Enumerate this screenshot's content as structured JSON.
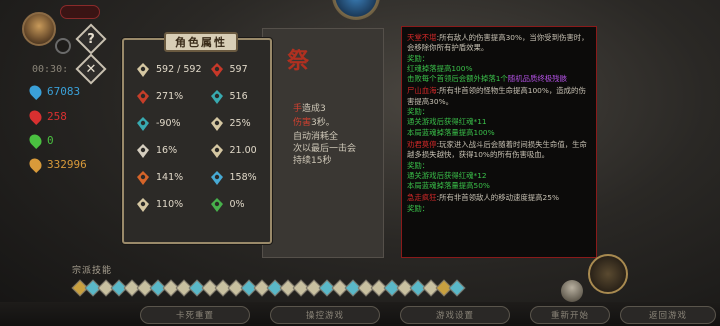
{
  "hud": {
    "timer": "00:30:",
    "help_label": "?",
    "close_label": "✕",
    "resources": [
      {
        "icon": "soul-flame-icon",
        "value": "67083",
        "color": "#3aa0d8"
      },
      {
        "icon": "blood-drop-icon",
        "value": "258",
        "color": "#d83030"
      },
      {
        "icon": "green-flame-icon",
        "value": "0",
        "color": "#4ac040"
      },
      {
        "icon": "gold-swirl-icon",
        "value": "332996",
        "color": "#d89a3a"
      }
    ]
  },
  "attributes": {
    "title": "角色属性",
    "items": [
      {
        "icon": "health-heart-icon",
        "value": "592 / 592",
        "color": "#e8d8b0"
      },
      {
        "icon": "attack-claw-icon",
        "value": "597",
        "color": "#d83a2a"
      },
      {
        "icon": "crit-chance-icon",
        "value": "271%",
        "color": "#d8402a"
      },
      {
        "icon": "crit-damage-icon",
        "value": "516",
        "color": "#3ab8c0"
      },
      {
        "icon": "dodge-icon",
        "value": "-90%",
        "color": "#3ab8c0"
      },
      {
        "icon": "armor-shred-icon",
        "value": "25%",
        "color": "#e8d8b0"
      },
      {
        "icon": "defense-shield-icon",
        "value": "16%",
        "color": "#e8e0d0"
      },
      {
        "icon": "move-speed-icon",
        "value": "21.00",
        "color": "#e8d8b0"
      },
      {
        "icon": "fire-damage-icon",
        "value": "141%",
        "color": "#e86a2a"
      },
      {
        "icon": "frost-damage-icon",
        "value": "158%",
        "color": "#4ab8e8"
      },
      {
        "icon": "lightning-icon",
        "value": "110%",
        "color": "#e8d8b0"
      },
      {
        "icon": "poison-icon",
        "value": "0%",
        "color": "#4ac050"
      }
    ]
  },
  "mid_panel": {
    "glyph": "祭",
    "lines": [
      {
        "prefix": "手",
        "text": "造成3",
        "red_prefix": true
      },
      {
        "prefix": "伤害",
        "text": "3秒。",
        "red_prefix": true
      },
      {
        "prefix": "",
        "text": "自动消耗全",
        "red_prefix": false
      },
      {
        "prefix": "",
        "text": "次以最后一击会",
        "red_prefix": false
      },
      {
        "prefix": "",
        "text": "持续15秒",
        "red_prefix": false
      }
    ]
  },
  "tooltip": {
    "sections": [
      {
        "title": "天堂不堪",
        "desc": ":所有敌人的伤害提高30%，当你受到伤害时，会移除你所有护盾效果。",
        "reward_label": "奖励：",
        "rewards": [
          {
            "text": "红魂掉落提高100%",
            "color": "green"
          },
          {
            "text": "击败每个首领后会额外掉落1个",
            "color": "green",
            "suffix": "随机品质终极残骸",
            "suffix_color": "purple"
          }
        ]
      },
      {
        "title": "尸山血海",
        "desc": ":所有非首领的怪物生命提高100%，造成的伤害提高30%。",
        "reward_label": "奖励：",
        "rewards": [
          {
            "text": "通关游戏后获得红魂*11",
            "color": "green"
          },
          {
            "text": "本局蓝魂掉落量提高100%",
            "color": "green"
          }
        ]
      },
      {
        "title": "劝君莫停",
        "desc": ":玩家进入战斗后会随着时间损失生命值，生命越多损失越快，获得10%的所有伤害吸血。",
        "reward_label": "奖励：",
        "rewards": [
          {
            "text": "通关游戏后获得红魂*12",
            "color": "green"
          },
          {
            "text": "本局蓝魂掉落量提高50%",
            "color": "green"
          }
        ]
      },
      {
        "title": "急走疯狂",
        "desc": ":所有非首领敌人的移动速度提高25%",
        "reward_label": "奖励：",
        "rewards": []
      }
    ]
  },
  "bottom": {
    "skills_label": "宗派技能",
    "skill_colors": [
      "#c8a040",
      "#5ab8c8",
      "#c8c0a0",
      "#5ab8c8",
      "#c8c0a0",
      "#c8c0a0",
      "#5ab8c8",
      "#c8c0a0",
      "#c8c0a0",
      "#5ab8c8",
      "#c8c0a0",
      "#c8c0a0",
      "#c8c0a0",
      "#5ab8c8",
      "#c8c0a0",
      "#5ab8c8",
      "#c8c0a0",
      "#c8c0a0",
      "#c8c0a0",
      "#5ab8c8",
      "#c8c0a0",
      "#5ab8c8",
      "#c8c0a0",
      "#c8c0a0",
      "#5ab8c8",
      "#c8c0a0",
      "#5ab8c8",
      "#c8c0a0",
      "#c8a040",
      "#5ab8c8"
    ],
    "buttons": [
      "卡死重置",
      "操控游戏",
      "游戏设置",
      "重新开始",
      "返回游戏"
    ]
  }
}
